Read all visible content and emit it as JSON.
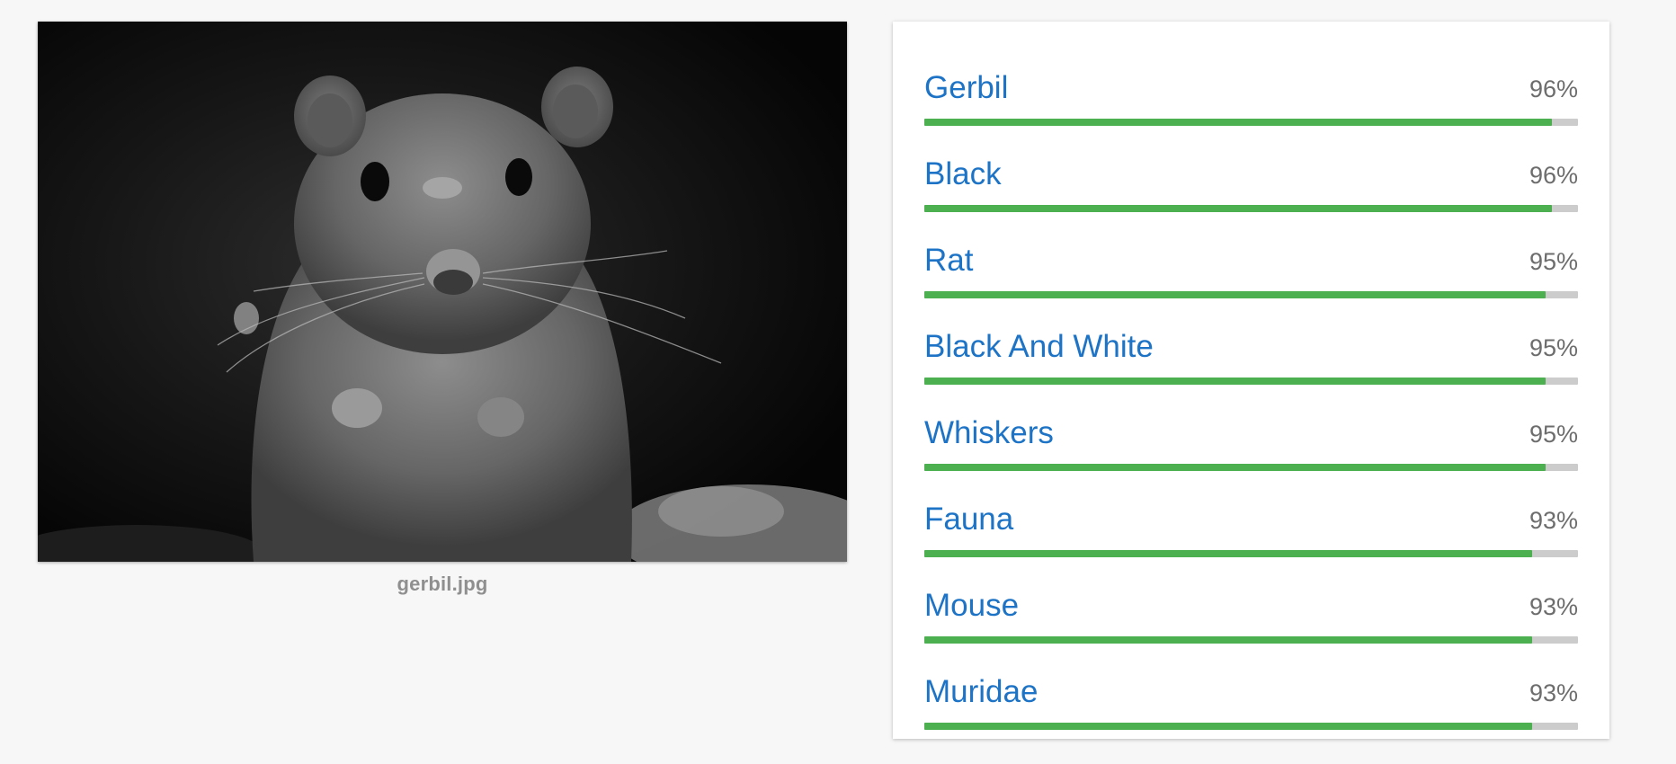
{
  "image": {
    "filename": "gerbil.jpg",
    "alt": "Gerbil"
  },
  "labels": [
    {
      "name": "Gerbil",
      "score": "96%",
      "value": 0.96
    },
    {
      "name": "Black",
      "score": "96%",
      "value": 0.96
    },
    {
      "name": "Rat",
      "score": "95%",
      "value": 0.95
    },
    {
      "name": "Black And White",
      "score": "95%",
      "value": 0.95
    },
    {
      "name": "Whiskers",
      "score": "95%",
      "value": 0.95
    },
    {
      "name": "Fauna",
      "score": "93%",
      "value": 0.93
    },
    {
      "name": "Mouse",
      "score": "93%",
      "value": 0.93
    },
    {
      "name": "Muridae",
      "score": "93%",
      "value": 0.93
    }
  ],
  "colors": {
    "label_text": "#1d73c5",
    "bar_fill": "#4caf50",
    "bar_track": "#cccccc",
    "score_text": "#6d6d6d"
  }
}
